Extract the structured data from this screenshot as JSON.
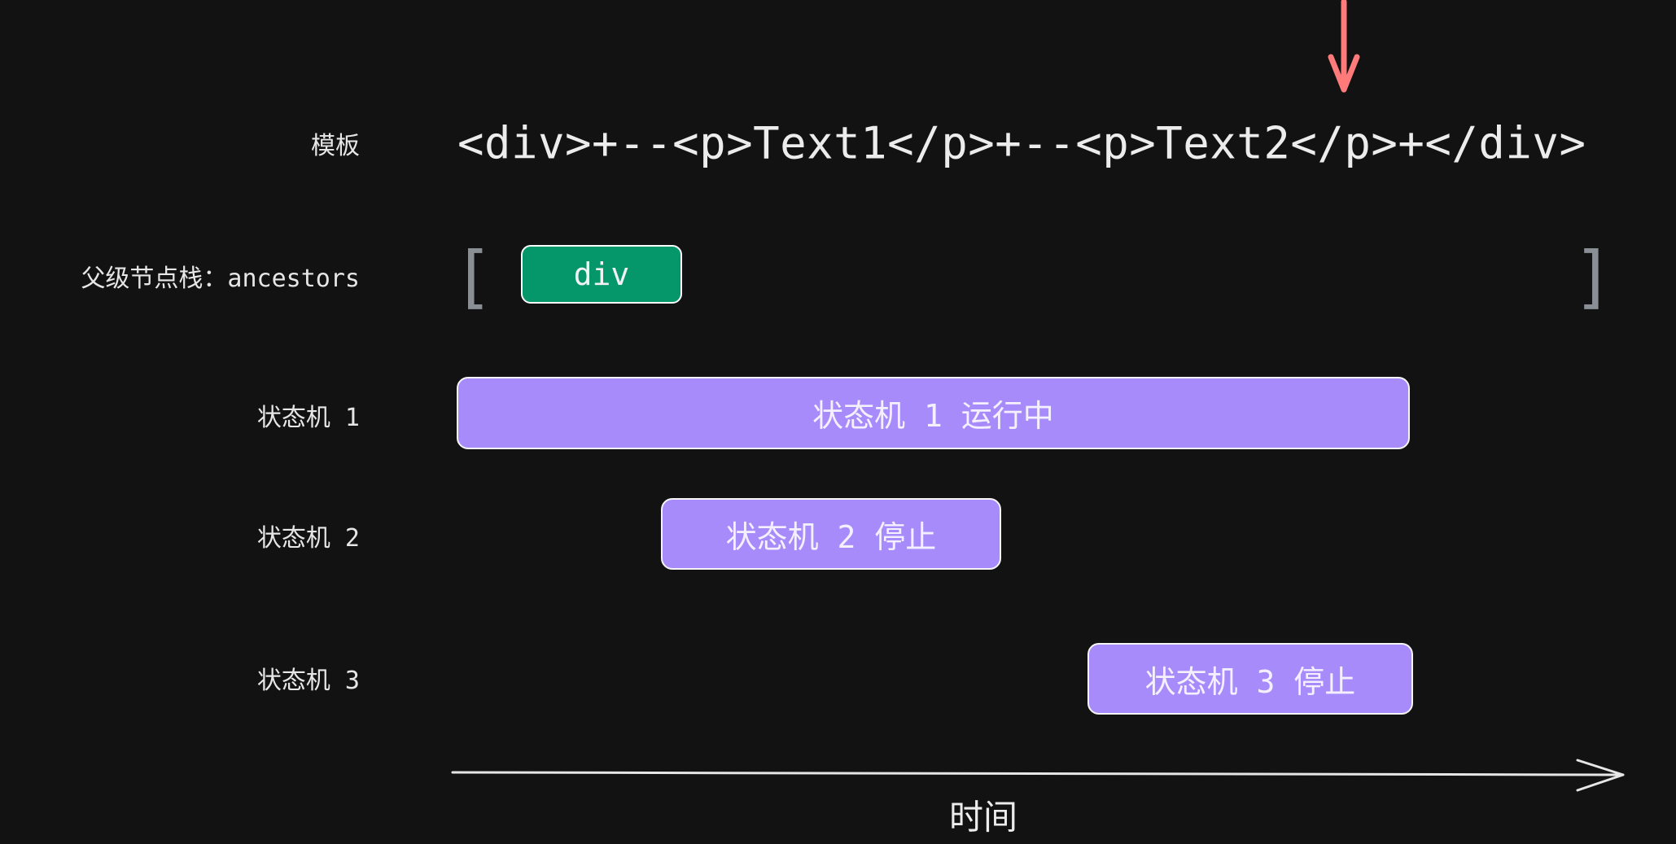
{
  "labels": {
    "template": "模板",
    "ancestors": "父级节点栈：ancestors",
    "machine1": "状态机 1",
    "machine2": "状态机 2",
    "machine3": "状态机 3"
  },
  "template": {
    "text": "<div>+--<p>Text1</p>+--<p>Text2</p>+</div>"
  },
  "stack": {
    "open_bracket": "[",
    "close_bracket": "]",
    "items": [
      "div"
    ]
  },
  "machines": [
    {
      "label": "状态机 1 运行中"
    },
    {
      "label": "状态机 2 停止"
    },
    {
      "label": "状态机 3 停止"
    }
  ],
  "axis": {
    "label": "时间"
  },
  "colors": {
    "background": "#121212",
    "stack_item": "#059669",
    "machine_bar": "#a78bfa",
    "pointer_arrow": "#ff7b7b"
  }
}
